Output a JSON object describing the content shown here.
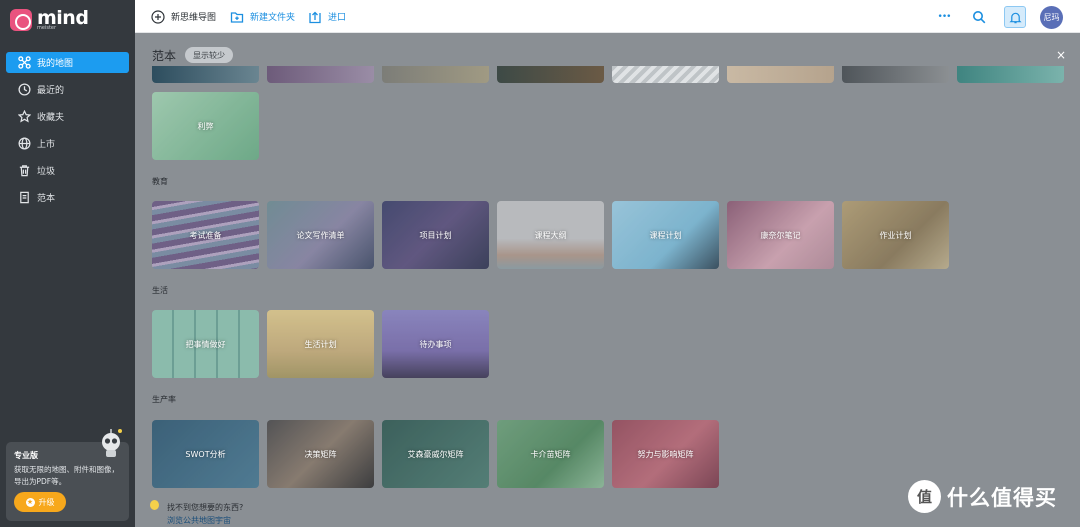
{
  "app": {
    "logo_word": "mind",
    "logo_sub": "meister"
  },
  "sidebar": {
    "items": [
      {
        "label": "我的地图",
        "icon": "mindmap-icon",
        "active": true
      },
      {
        "label": "最近的",
        "icon": "clock-icon"
      },
      {
        "label": "收藏夫",
        "icon": "star-icon"
      },
      {
        "label": "上市",
        "icon": "globe-icon"
      },
      {
        "label": "垃圾",
        "icon": "trash-icon"
      },
      {
        "label": "范本",
        "icon": "template-icon"
      }
    ],
    "promo": {
      "title": "专业版",
      "desc": "获取无限的地图、附件和图像，导出为PDF等。",
      "button": "升级"
    }
  },
  "toolbar": {
    "new_map": "新思维导图",
    "new_folder": "新建文件夹",
    "import": "进口",
    "more": "•••",
    "avatar": "尼玛"
  },
  "main": {
    "title": "范本",
    "toggle": "显示较少",
    "close": "×",
    "sections": [
      {
        "name": "教育",
        "cards": [
          "考试准备",
          "论文写作清单",
          "项目计划",
          "课程大纲",
          "课程计划",
          "康奈尔笔记",
          "作业计划"
        ]
      },
      {
        "name": "生活",
        "cards": [
          "把事情做好",
          "生活计划",
          "待办事项"
        ]
      },
      {
        "name": "生产率",
        "cards": [
          "SWOT分析",
          "决策矩阵",
          "艾森豪威尔矩阵",
          "卡介苗矩阵",
          "努力与影响矩阵"
        ]
      }
    ],
    "top_card": "利弊",
    "help_line1": "找不到您想要的东西?",
    "help_line2": "浏览公共地图宇宙"
  },
  "watermark": {
    "text": "什么值得买",
    "badge": "值"
  },
  "colors": {
    "accent": "#1c9cf0",
    "sidebar_bg": "#34393e",
    "upgrade": "#f7a81c"
  }
}
